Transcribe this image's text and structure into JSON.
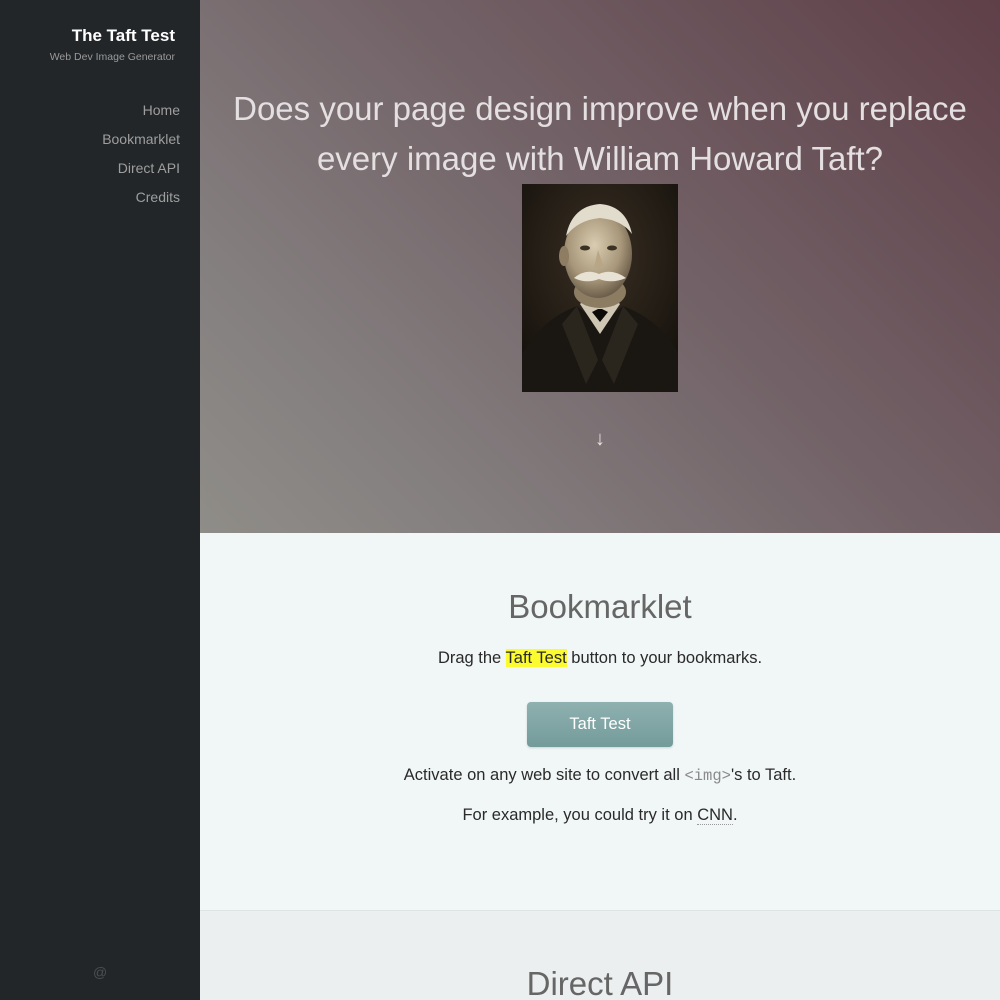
{
  "sidebar": {
    "title": "The Taft Test",
    "subtitle": "Web Dev Image Generator",
    "nav": [
      {
        "label": "Home"
      },
      {
        "label": "Bookmarklet"
      },
      {
        "label": "Direct API"
      },
      {
        "label": "Credits"
      }
    ],
    "footer_icon": "@"
  },
  "hero": {
    "heading": "Does your page design improve when you replace every image with William Howard Taft?",
    "portrait_icon": "taft-portrait",
    "scroll_arrow": "↓"
  },
  "bookmarklet": {
    "heading": "Bookmarklet",
    "drag_before": "Drag the ",
    "drag_highlight": "Taft Test",
    "drag_after": " button to your bookmarks.",
    "button_label": "Taft Test",
    "activate_before": "Activate on any web site to convert all ",
    "activate_code": "<img>",
    "activate_after": "'s to Taft.",
    "example_before": "For example, you could try it on ",
    "example_link": "CNN",
    "example_after": "."
  },
  "direct_api": {
    "heading": "Direct API"
  },
  "colors": {
    "sidebar_bg": "#222629",
    "button_bg": "#7fa6a5",
    "highlight": "#fbfb2f"
  }
}
